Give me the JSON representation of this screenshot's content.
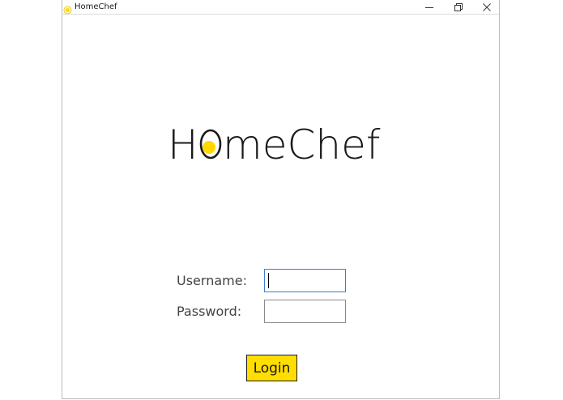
{
  "window": {
    "title": "HomeChef",
    "controls": {
      "minimize": "minimize-icon",
      "restore": "restore-icon",
      "close": "close-icon"
    }
  },
  "logo": {
    "prefix": "H",
    "suffix": "meChef",
    "o_fill_color": "#ffd800"
  },
  "form": {
    "username_label": "Username:",
    "username_value": "",
    "password_label": "Password:",
    "password_value": "",
    "login_label": "Login"
  },
  "colors": {
    "button_bg": "#ffde00",
    "focus_border": "#3c7dd0"
  }
}
